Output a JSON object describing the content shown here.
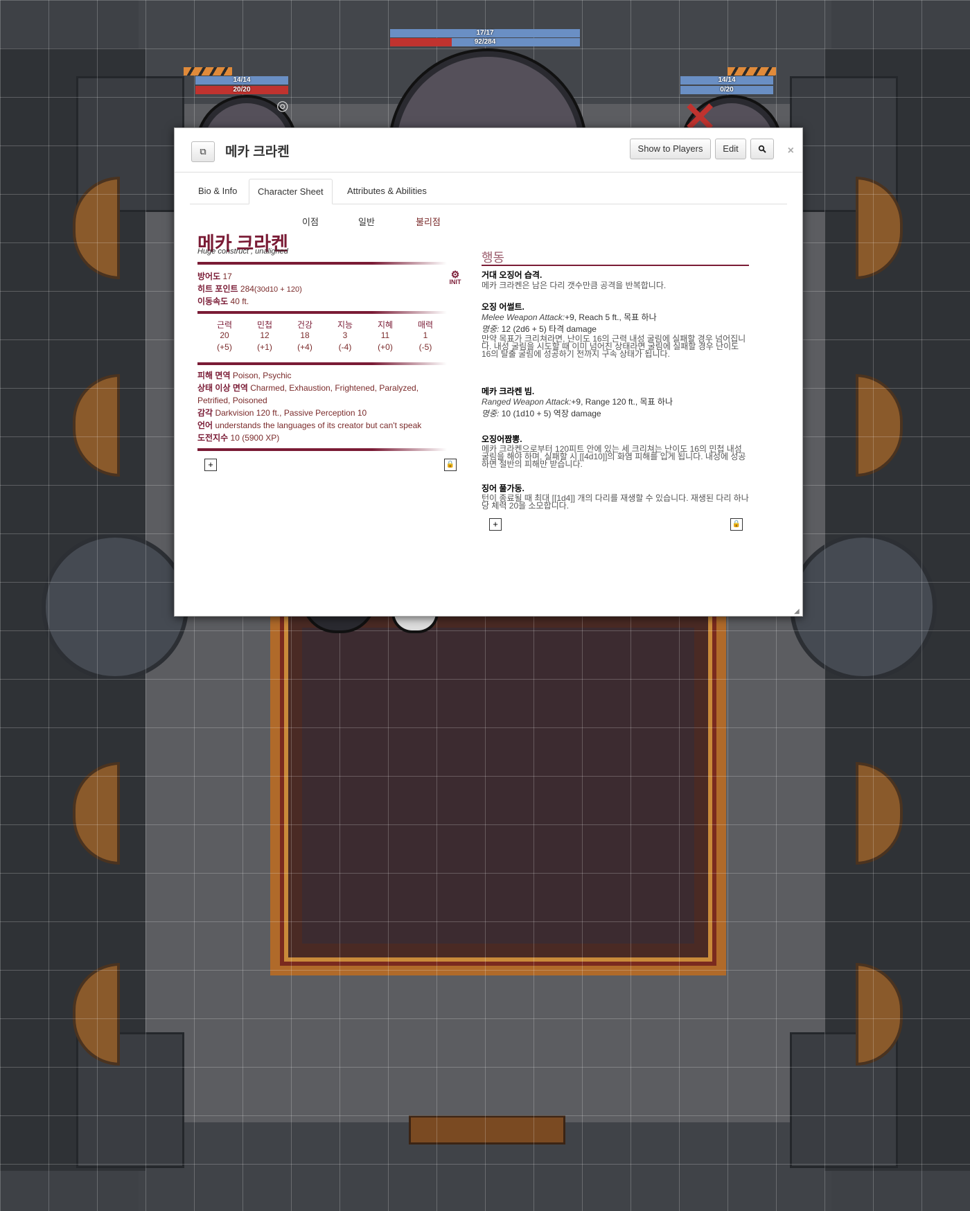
{
  "map": {
    "tokens": [
      {
        "name": "top-token",
        "hp_text": "17/17",
        "hp2_text": "92/284",
        "hp2_fraction": 0.324
      },
      {
        "name": "left-token",
        "hp_text": "14/14",
        "hp2_text": "20/20",
        "hp2_fraction": 1.0
      },
      {
        "name": "right-token",
        "hp_text": "14/14",
        "hp2_text": "0/20",
        "hp2_fraction": 0.0
      }
    ]
  },
  "dialog": {
    "title": "메카 크라켄",
    "buttons": {
      "show": "Show to Players",
      "edit": "Edit",
      "search_icon": "search-icon"
    },
    "close": "×",
    "tabs": [
      "Bio & Info",
      "Character Sheet",
      "Attributes & Abilities"
    ],
    "adv": {
      "adv": "이점",
      "normal": "일반",
      "dis": "불리점"
    },
    "npc": {
      "name": "메카 크라켄",
      "type": "Huge construct , unaligned",
      "ac_label": "방어도",
      "ac_value": "17",
      "hp_label": "히트 포인트",
      "hp_value": "284",
      "hp_formula": "(30d10 + 120)",
      "speed_label": "이동속도",
      "speed_value": "40 ft.",
      "init": "INIT"
    },
    "abilities": [
      {
        "label": "근력",
        "score": "20",
        "mod": "(+5)"
      },
      {
        "label": "민첩",
        "score": "12",
        "mod": "(+1)"
      },
      {
        "label": "건강",
        "score": "18",
        "mod": "(+4)"
      },
      {
        "label": "지능",
        "score": "3",
        "mod": "(-4)"
      },
      {
        "label": "지혜",
        "score": "11",
        "mod": "(+0)"
      },
      {
        "label": "매력",
        "score": "1",
        "mod": "(-5)"
      }
    ],
    "props": {
      "dmg_imm_label": "피해 면역",
      "dmg_imm": "Poison, Psychic",
      "cond_imm_label": "상태 이상 면역",
      "cond_imm": "Charmed, Exhaustion, Frightened, Paralyzed, Petrified, Poisoned",
      "senses_label": "감각",
      "senses": "Darkvision 120 ft., Passive Perception 10",
      "lang_label": "언어",
      "lang": "understands the languages of its creator but can't speak",
      "cr_label": "도전지수",
      "cr": "10 (5900 XP)"
    },
    "actions_title": "행동",
    "actions": [
      {
        "name": "거대 오징어 습격.",
        "desc": "메카 크라켄은 남은 다리 갯수만큼 공격을 반복합니다."
      },
      {
        "name": "오징 어썰트.",
        "attack": "Melee Weapon Attack:",
        "attack_rest": "+9, Reach 5 ft., 목표 하나",
        "hit_label": "명중:",
        "hit": " 12 (2d6 + 5) 타격 damage",
        "desc": "만약 목표가 크리쳐라면, 난이도 16의 근력 내성 굴림에 실패할 경우 넘어집니다. 내성 굴림을 시도할 때 이미 넘어진 상태라면 굴림에 실패할 경우 난이도 16의 탈출 굴림에 성공하기 전까지 구속 상태가 됩니다."
      },
      {
        "name": "메카 크라켄 빔.",
        "attack": "Ranged Weapon Attack:",
        "attack_rest": "+9, Range 120 ft., 목표 하나",
        "hit_label": "명중:",
        "hit": " 10 (1d10 + 5) 역장 damage"
      },
      {
        "name": "오징어짬뽕.",
        "desc": "메카 크라켄으로부터 120피트 안에 있는 세 크리쳐는 난이도 16의 민첩 내성 굴림을 해야 하며, 실패할 시 [[4d10]]의 화염 피해를 입게 됩니다. 내성에 성공하면 절반의 피해만 받습니다."
      },
      {
        "name": "징어 풀가동.",
        "desc": "턴이 종료될 때 최대 [[1d4]] 개의 다리를 재생할 수 있습니다. 재생된 다리 하나당 체력 20을 소모합니다."
      }
    ]
  }
}
